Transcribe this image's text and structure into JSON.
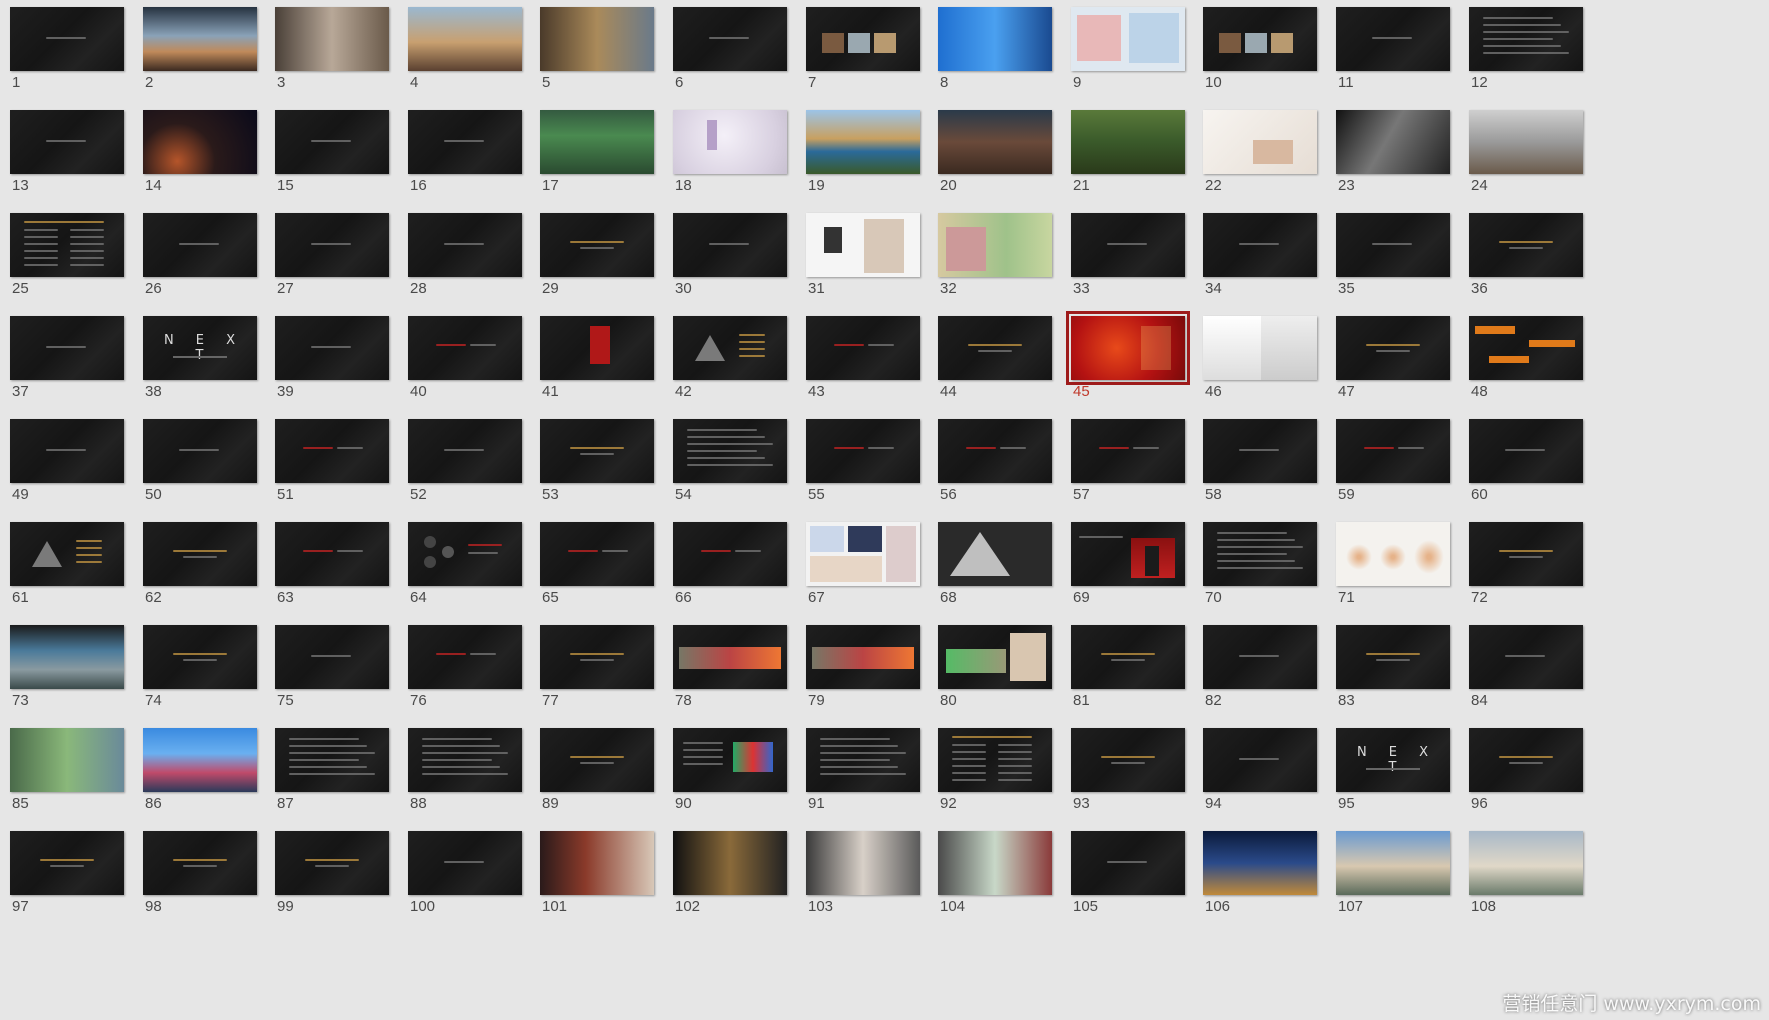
{
  "sorter": {
    "selected_slide": "45",
    "slides": [
      {
        "number": "1",
        "look": "dark"
      },
      {
        "number": "2",
        "look": "photo-interior"
      },
      {
        "number": "3",
        "look": "photo-building"
      },
      {
        "number": "4",
        "look": "photo-courtyard"
      },
      {
        "number": "5",
        "look": "photo-street"
      },
      {
        "number": "6",
        "look": "dark"
      },
      {
        "number": "7",
        "look": "dark-photos"
      },
      {
        "number": "8",
        "look": "photo-blue"
      },
      {
        "number": "9",
        "look": "maps"
      },
      {
        "number": "10",
        "look": "dark-photos"
      },
      {
        "number": "11",
        "look": "dark"
      },
      {
        "number": "12",
        "look": "dark-text"
      },
      {
        "number": "13",
        "look": "dark"
      },
      {
        "number": "14",
        "look": "photo-space"
      },
      {
        "number": "15",
        "look": "dark"
      },
      {
        "number": "16",
        "look": "dark"
      },
      {
        "number": "17",
        "look": "photo-forest"
      },
      {
        "number": "18",
        "look": "photo-light"
      },
      {
        "number": "19",
        "look": "photo-lake"
      },
      {
        "number": "20",
        "look": "photo-hut"
      },
      {
        "number": "21",
        "look": "photo-tree"
      },
      {
        "number": "22",
        "look": "photo-baby"
      },
      {
        "number": "23",
        "look": "photo-dark-wave"
      },
      {
        "number": "24",
        "look": "photo-room"
      },
      {
        "number": "25",
        "look": "dark-list"
      },
      {
        "number": "26",
        "look": "dark"
      },
      {
        "number": "27",
        "look": "dark"
      },
      {
        "number": "28",
        "look": "dark"
      },
      {
        "number": "29",
        "look": "dark-gold"
      },
      {
        "number": "30",
        "look": "dark"
      },
      {
        "number": "31",
        "look": "photo-white"
      },
      {
        "number": "32",
        "look": "photo-people"
      },
      {
        "number": "33",
        "look": "dark"
      },
      {
        "number": "34",
        "look": "dark"
      },
      {
        "number": "35",
        "look": "dark"
      },
      {
        "number": "36",
        "look": "dark-gold"
      },
      {
        "number": "37",
        "look": "dark"
      },
      {
        "number": "38",
        "look": "next",
        "title": "N E X T"
      },
      {
        "number": "39",
        "look": "dark"
      },
      {
        "number": "40",
        "look": "dark-red"
      },
      {
        "number": "41",
        "look": "dark-red-figure"
      },
      {
        "number": "42",
        "look": "dark-triangle"
      },
      {
        "number": "43",
        "look": "dark-red"
      },
      {
        "number": "44",
        "look": "dark-gold"
      },
      {
        "number": "45",
        "look": "red-poster"
      },
      {
        "number": "46",
        "look": "calligraphy"
      },
      {
        "number": "47",
        "look": "dark-gold"
      },
      {
        "number": "48",
        "look": "dark-orange"
      },
      {
        "number": "49",
        "look": "dark"
      },
      {
        "number": "50",
        "look": "dark"
      },
      {
        "number": "51",
        "look": "dark-red"
      },
      {
        "number": "52",
        "look": "dark"
      },
      {
        "number": "53",
        "look": "dark-gold"
      },
      {
        "number": "54",
        "look": "dark-text"
      },
      {
        "number": "55",
        "look": "dark-red"
      },
      {
        "number": "56",
        "look": "dark-red"
      },
      {
        "number": "57",
        "look": "dark-red"
      },
      {
        "number": "58",
        "look": "dark"
      },
      {
        "number": "59",
        "look": "dark-red"
      },
      {
        "number": "60",
        "look": "dark"
      },
      {
        "number": "61",
        "look": "dark-triangle"
      },
      {
        "number": "62",
        "look": "dark-gold"
      },
      {
        "number": "63",
        "look": "dark-red"
      },
      {
        "number": "64",
        "look": "dark-circles"
      },
      {
        "number": "65",
        "look": "dark-red"
      },
      {
        "number": "66",
        "look": "dark-red"
      },
      {
        "number": "67",
        "look": "collage"
      },
      {
        "number": "68",
        "look": "pyramid"
      },
      {
        "number": "69",
        "look": "dark-red-person"
      },
      {
        "number": "70",
        "look": "dark-text"
      },
      {
        "number": "71",
        "look": "sketch-light"
      },
      {
        "number": "72",
        "look": "dark-gold"
      },
      {
        "number": "73",
        "look": "photo-landscape"
      },
      {
        "number": "74",
        "look": "dark-gold"
      },
      {
        "number": "75",
        "look": "dark"
      },
      {
        "number": "76",
        "look": "dark-red"
      },
      {
        "number": "77",
        "look": "dark-gold"
      },
      {
        "number": "78",
        "look": "dark-photo-strip"
      },
      {
        "number": "79",
        "look": "dark-photo-strip"
      },
      {
        "number": "80",
        "look": "dark-photo-map"
      },
      {
        "number": "81",
        "look": "dark-gold"
      },
      {
        "number": "82",
        "look": "dark"
      },
      {
        "number": "83",
        "look": "dark-gold"
      },
      {
        "number": "84",
        "look": "dark"
      },
      {
        "number": "85",
        "look": "photo-green"
      },
      {
        "number": "86",
        "look": "photo-supertrees"
      },
      {
        "number": "87",
        "look": "dark-text"
      },
      {
        "number": "88",
        "look": "dark-text"
      },
      {
        "number": "89",
        "look": "dark-gold"
      },
      {
        "number": "90",
        "look": "dark-colorful"
      },
      {
        "number": "91",
        "look": "dark-text"
      },
      {
        "number": "92",
        "look": "dark-list"
      },
      {
        "number": "93",
        "look": "dark-gold"
      },
      {
        "number": "94",
        "look": "dark"
      },
      {
        "number": "95",
        "look": "next",
        "title": "N E X T"
      },
      {
        "number": "96",
        "look": "dark-gold"
      },
      {
        "number": "97",
        "look": "dark-gold"
      },
      {
        "number": "98",
        "look": "dark-gold"
      },
      {
        "number": "99",
        "look": "dark-gold"
      },
      {
        "number": "100",
        "look": "dark"
      },
      {
        "number": "101",
        "look": "photo-bags"
      },
      {
        "number": "102",
        "look": "photo-watches"
      },
      {
        "number": "103",
        "look": "photo-fashion"
      },
      {
        "number": "104",
        "look": "photo-fashion-2"
      },
      {
        "number": "105",
        "look": "dark"
      },
      {
        "number": "106",
        "look": "photo-night"
      },
      {
        "number": "107",
        "look": "photo-hotel"
      },
      {
        "number": "108",
        "look": "photo-hotel-2"
      }
    ]
  },
  "watermark": {
    "text": "营销任意门 www.yxrym.com"
  },
  "colors": {
    "background": "#e6e6e6",
    "selection": "#9e1b1b",
    "selected_number": "#c0392b",
    "number": "#4a4a4a"
  }
}
